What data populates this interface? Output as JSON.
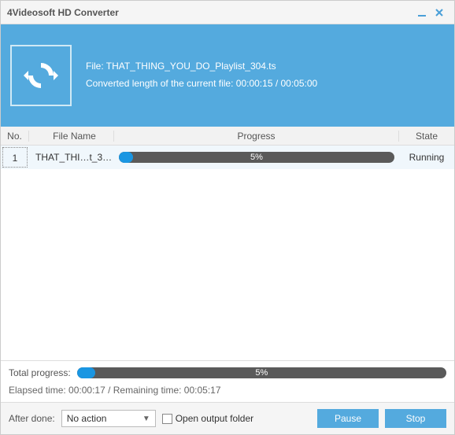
{
  "window": {
    "title": "4Videosoft HD Converter"
  },
  "header": {
    "file_label": "File: THAT_THING_YOU_DO_Playlist_304.ts",
    "converted_label": "Converted length of the current file: 00:00:15 / 00:05:00"
  },
  "columns": {
    "no": "No.",
    "filename": "File Name",
    "progress": "Progress",
    "state": "State"
  },
  "rows": [
    {
      "no": "1",
      "filename": "THAT_THI…t_304.ts",
      "percent": 5,
      "percent_text": "5%",
      "state": "Running"
    }
  ],
  "footer": {
    "total_label": "Total progress:",
    "total_percent": 5,
    "total_percent_text": "5%",
    "elapsed": "Elapsed time: 00:00:17 / Remaining time: 00:05:17"
  },
  "actionbar": {
    "after_done_label": "After done:",
    "after_done_value": "No action",
    "open_folder_label": "Open output folder",
    "open_folder_checked": false,
    "pause": "Pause",
    "stop": "Stop"
  },
  "colors": {
    "accent": "#54aade",
    "progress_bg": "#5a5a5a",
    "progress_fill": "#1a96e2"
  }
}
